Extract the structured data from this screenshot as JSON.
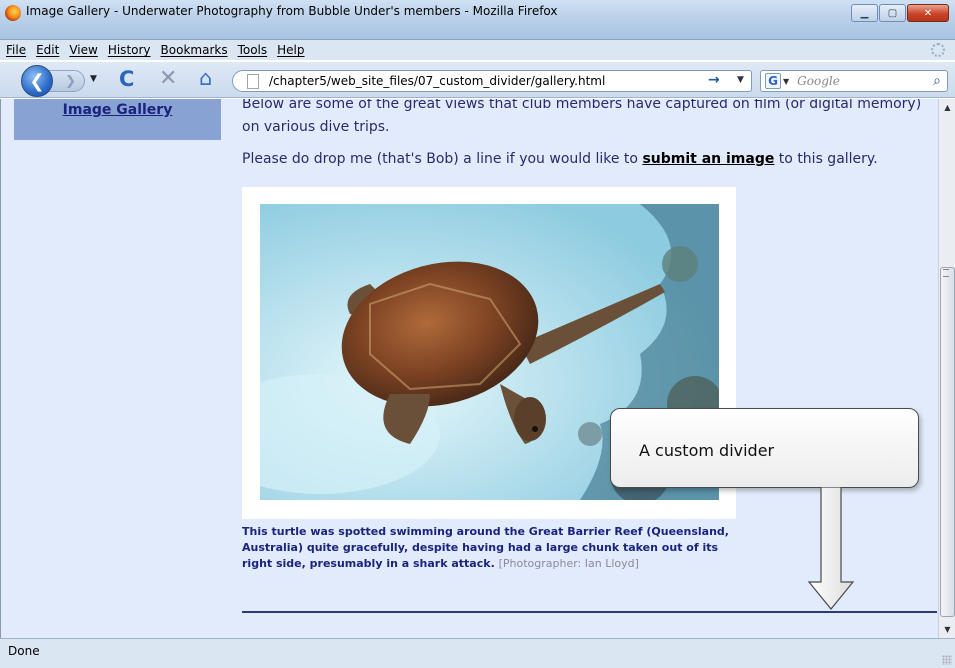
{
  "window": {
    "title": "Image Gallery - Underwater Photography from Bubble Under's members - Mozilla Firefox",
    "buttons": {
      "minimize": "▁",
      "maximize": "▢",
      "close": "✕"
    }
  },
  "menu": [
    "File",
    "Edit",
    "View",
    "History",
    "Bookmarks",
    "Tools",
    "Help"
  ],
  "toolbar": {
    "url": "/chapter5/web_site_files/07_custom_divider/gallery.html",
    "search_placeholder": "Google",
    "search_engine_letter": "G",
    "back_glyph": "❮",
    "forward_glyph": "❯",
    "reload_glyph": "C",
    "stop_glyph": "✕",
    "home_glyph": "⌂",
    "go_glyph": "→",
    "search_glyph": "⌕"
  },
  "sidebar": {
    "current_item": "Image Gallery"
  },
  "content": {
    "intro": "Below are some of the great views that club members have captured on film (or digital memory) on various dive trips.",
    "submit_pre": "Please do drop me (that's Bob) a line if you would like to ",
    "submit_link": "submit an image",
    "submit_post": " to this gallery.",
    "caption": "This turtle was spotted swimming around the Great Barrier Reef (Queensland, Australia) quite gracefully, despite having had a large chunk taken out of its right side, presumably in a shark attack.",
    "credit": "[Photographer: Ian Lloyd]"
  },
  "annotation": {
    "callout_text": "A custom divider"
  },
  "status": {
    "text": "Done"
  },
  "colors": {
    "page_bg": "#e2ebfb",
    "nav_current_bg": "#88a3d3",
    "link": "#1a237e",
    "divider": "#2a3a7a"
  },
  "icons": [
    "firefox-logo-icon",
    "back-arrow-icon",
    "forward-arrow-icon",
    "reload-icon",
    "stop-icon",
    "home-icon",
    "page-icon",
    "go-arrow-icon",
    "google-icon",
    "magnifier-icon"
  ]
}
